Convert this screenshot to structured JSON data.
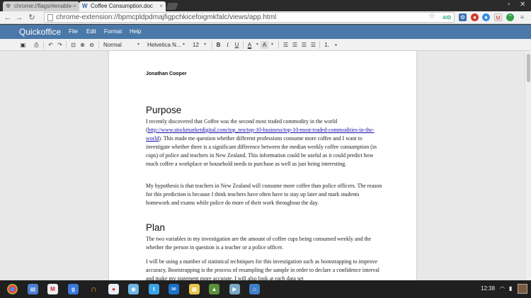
{
  "browser": {
    "tabs": [
      {
        "title": "chrome://flags/#enable-",
        "active": false
      },
      {
        "title": "Coffee Consumption.doc",
        "active": true
      }
    ],
    "url": "chrome-extension://bpmcpldpdmajfigpchkicefoigmkfalc/views/app.html",
    "omnibox_badge": "AID"
  },
  "app": {
    "name": "Quickoffice",
    "menu": [
      "File",
      "Edit",
      "Format",
      "Help"
    ]
  },
  "toolbar": {
    "style": "Normal",
    "font": "Helvetica N...",
    "size": "12",
    "bold": "B",
    "italic": "I",
    "underline": "U",
    "font_color": "A",
    "highlight": "A"
  },
  "document": {
    "author": "Jonathan Cooper",
    "heading1": "Purpose",
    "p1_a": "I recently discovered that Coffee was the second most traded commodity in the world (",
    "p1_link": "http://www.stockmarketdigital.com/top_ten/top-10-business/top-10-most-traded-commodities-in-the-world",
    "p1_b": ").  This made me question whether different professions consume more coffee and I want to investigate whether there is a significant difference between the median weekly coffee consumption (in cups) of police and teachers in New Zealand. This information could be useful as it could predict how much coffee a workplace or household needs to purchase as well as just being interesting.",
    "p2": "My hypothesis is that teachers in New Zealand will consume more coffee than police officers. The reason for this prediction is because I think teachers have often have to stay up later and mark students homework and exams while police do more of their work throughout the day.",
    "heading2": "Plan",
    "p3": "The two variables in my investigation are the amount of coffee cups being consumed weekly and the whether the person in question is a teacher or a police officer.",
    "p4": "I will be using a number of statistical techniques for this investigation such as bootstrapping to improve accuracy. Bootstrapping is the process of resampling the sample in order to declare a confidence interval and make my statement more accurate. I will also look at each data set"
  },
  "shelf": {
    "clock": "12:38",
    "apps": [
      "chrome",
      "files",
      "gmail",
      "google-plus",
      "music",
      "talk",
      "chat",
      "twitter",
      "mail",
      "photos",
      "drive",
      "play-store",
      "maps"
    ]
  },
  "colors": {
    "app_header": "#4a78a8",
    "link": "#1a0dab"
  }
}
